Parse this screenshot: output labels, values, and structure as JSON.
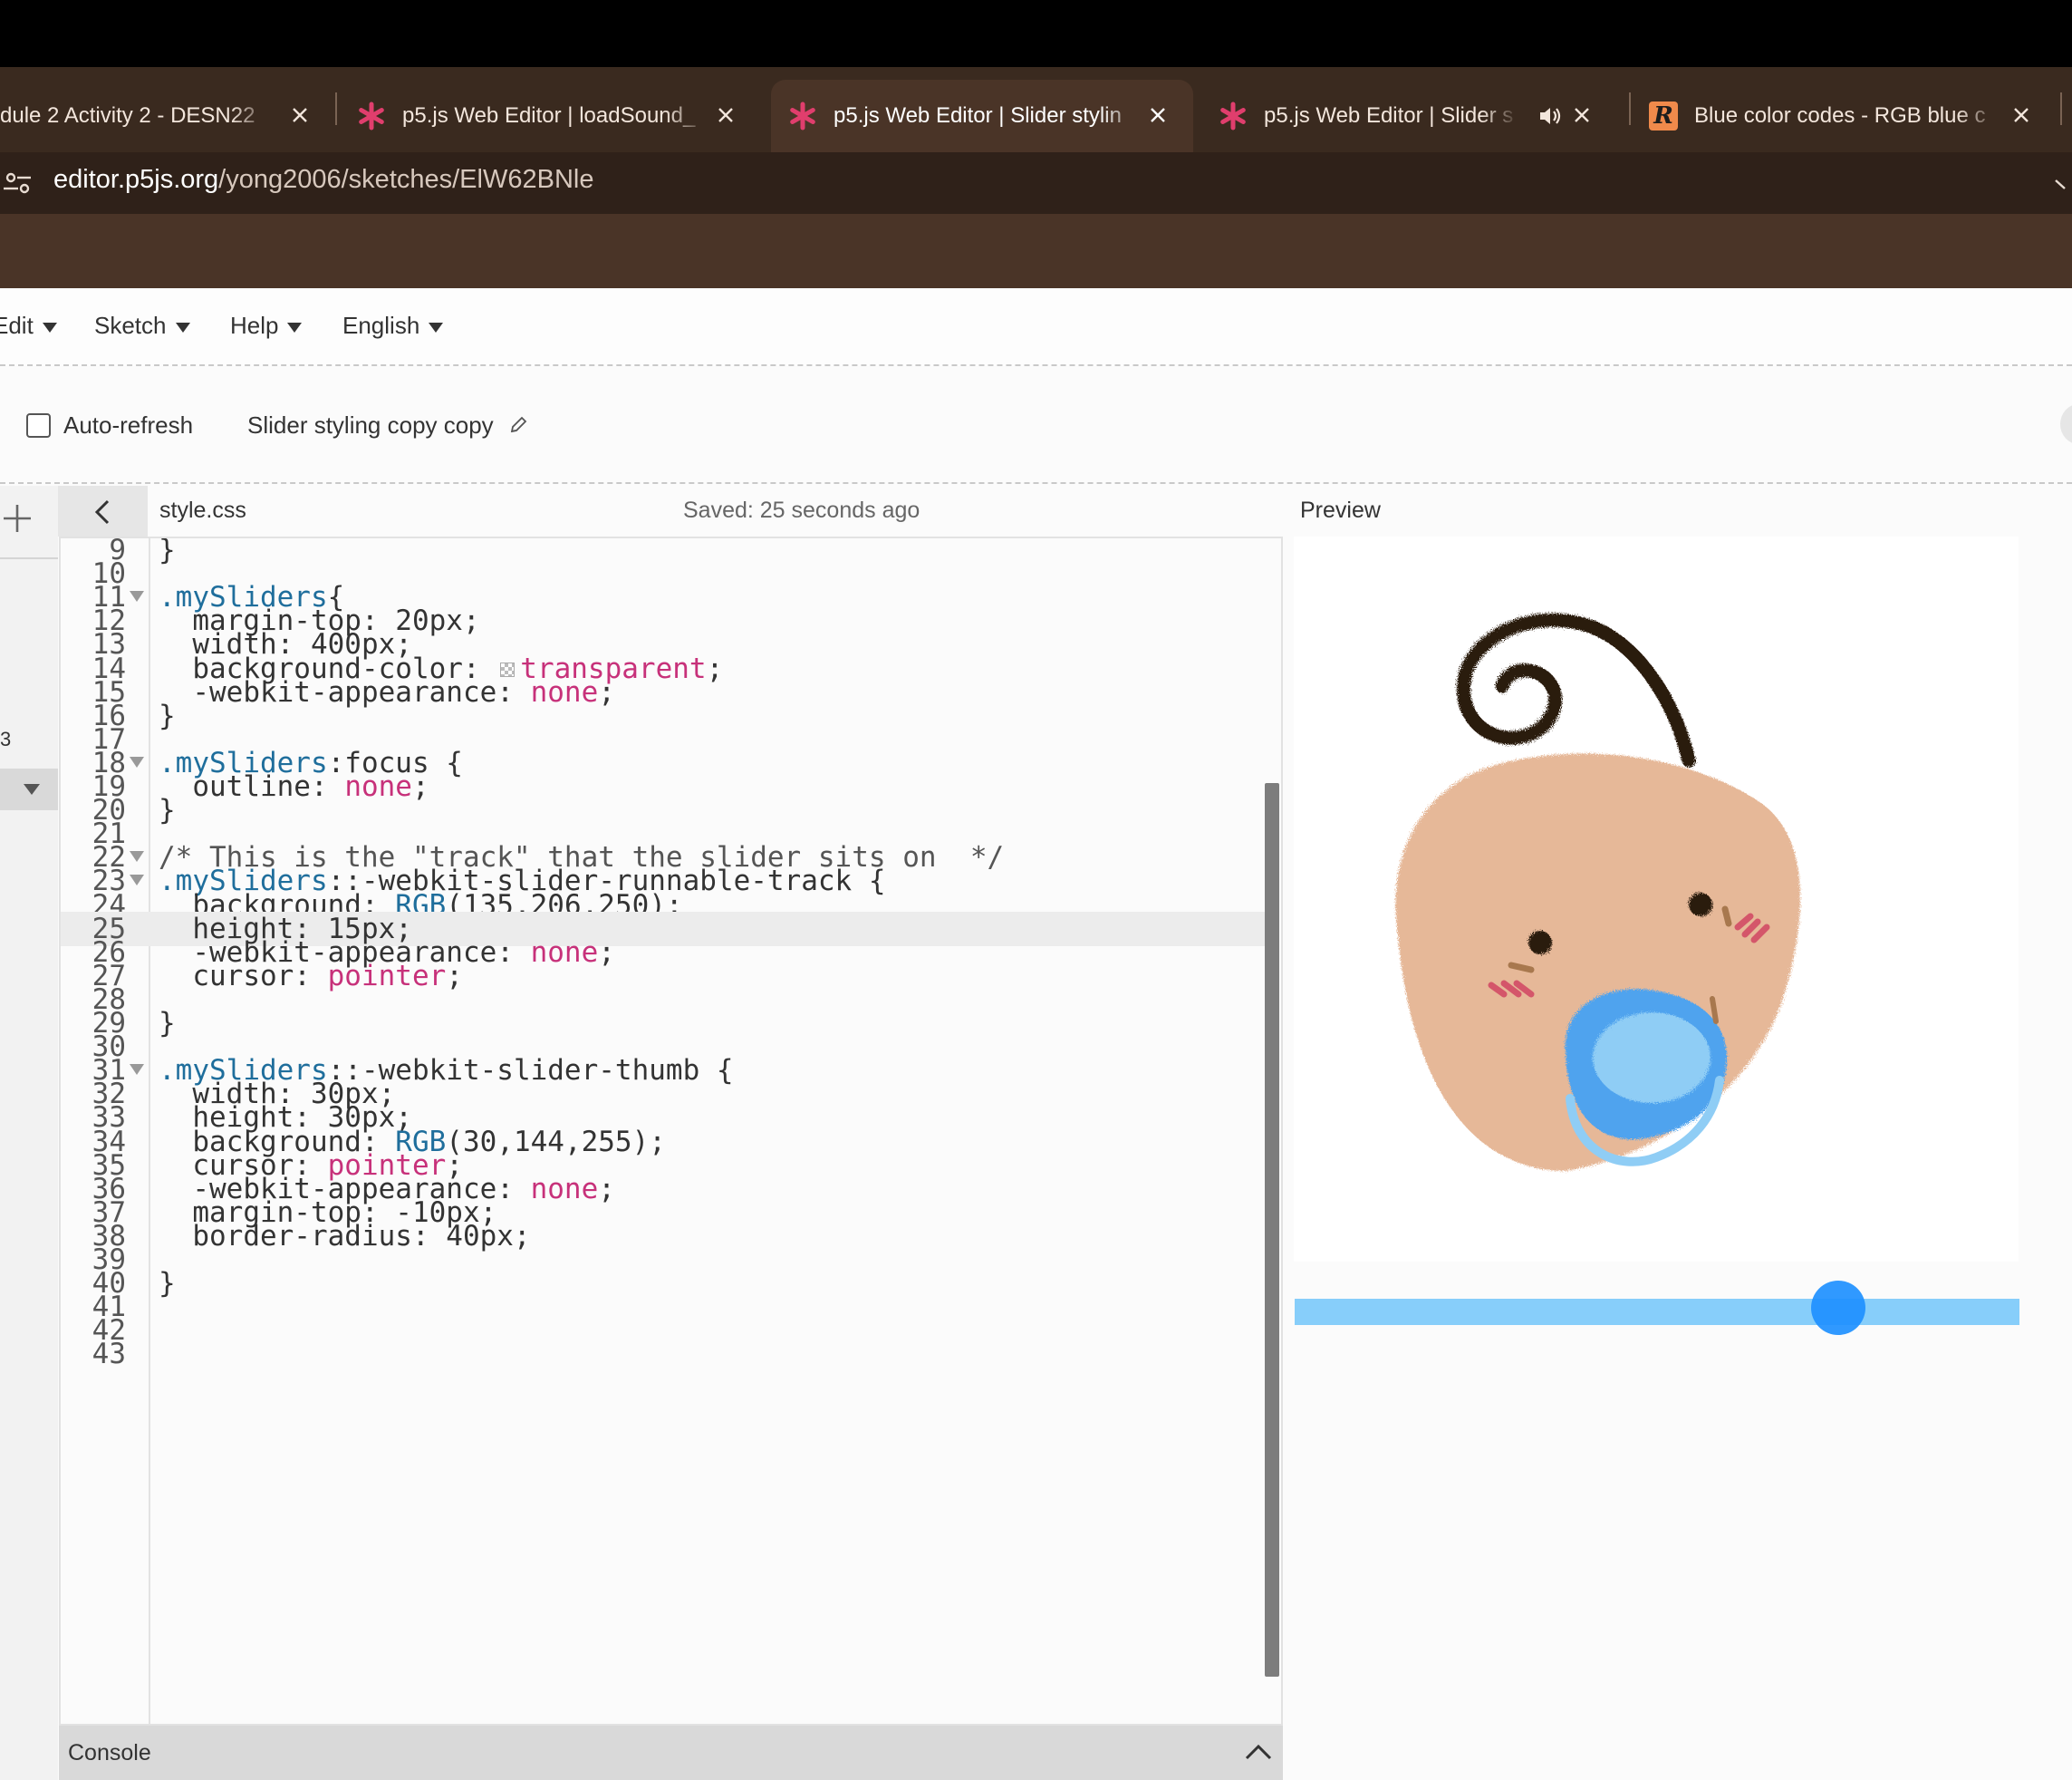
{
  "browser": {
    "tabs": [
      {
        "title": "dule 2 Activity 2 - DESN22",
        "active": false,
        "icon": "doc-icon"
      },
      {
        "title": "p5.js Web Editor | loadSound_",
        "active": false,
        "icon": "p5-asterisk-icon"
      },
      {
        "title": "p5.js Web Editor | Slider stylin",
        "active": true,
        "icon": "p5-asterisk-icon"
      },
      {
        "title": "p5.js Web Editor | Slider s",
        "active": false,
        "icon": "p5-asterisk-icon",
        "audio": true
      },
      {
        "title": "Blue color codes - RGB blue c",
        "active": false,
        "icon": "r-logo-icon",
        "logo_letter": "R"
      }
    ],
    "url": {
      "domain": "editor.p5js.org",
      "path": "/yong2006/sketches/ElW62BNle"
    },
    "accent": "#e03e6d"
  },
  "editor": {
    "menu": [
      {
        "label": "Edit"
      },
      {
        "label": "Sketch"
      },
      {
        "label": "Help"
      },
      {
        "label": "English"
      }
    ],
    "toolbar": {
      "auto_refresh_label": "Auto-refresh",
      "auto_refresh_checked": false,
      "sketch_name": "Slider styling copy copy"
    },
    "sidebar": {
      "partial_number": "3"
    },
    "file": {
      "name": "style.css",
      "saved_status": "Saved: 25 seconds ago"
    },
    "preview_label": "Preview",
    "console_label": "Console",
    "code_lines": [
      {
        "n": "9",
        "fold": false,
        "text": "}"
      },
      {
        "n": "10",
        "fold": false,
        "text": ""
      },
      {
        "n": "11",
        "fold": true,
        "text": ".mySliders{"
      },
      {
        "n": "12",
        "fold": false,
        "text": "  margin-top: 20px;"
      },
      {
        "n": "13",
        "fold": false,
        "text": "  width: 400px;"
      },
      {
        "n": "14",
        "fold": false,
        "text": "  background-color: transparent;"
      },
      {
        "n": "15",
        "fold": false,
        "text": "  -webkit-appearance: none;"
      },
      {
        "n": "16",
        "fold": false,
        "text": "}"
      },
      {
        "n": "17",
        "fold": false,
        "text": ""
      },
      {
        "n": "18",
        "fold": true,
        "text": ".mySliders:focus {"
      },
      {
        "n": "19",
        "fold": false,
        "text": "  outline: none;"
      },
      {
        "n": "20",
        "fold": false,
        "text": "}"
      },
      {
        "n": "21",
        "fold": false,
        "text": ""
      },
      {
        "n": "22",
        "fold": true,
        "text": "/* This is the \"track\" that the slider sits on  */"
      },
      {
        "n": "23",
        "fold": true,
        "text": ".mySliders::-webkit-slider-runnable-track {"
      },
      {
        "n": "24",
        "fold": false,
        "text": "  background: RGB(135,206,250);"
      },
      {
        "n": "25",
        "fold": false,
        "text": "  height: 15px;",
        "highlight": true
      },
      {
        "n": "26",
        "fold": false,
        "text": "  -webkit-appearance: none;"
      },
      {
        "n": "27",
        "fold": false,
        "text": "  cursor: pointer;"
      },
      {
        "n": "28",
        "fold": false,
        "text": ""
      },
      {
        "n": "29",
        "fold": false,
        "text": "}"
      },
      {
        "n": "30",
        "fold": false,
        "text": ""
      },
      {
        "n": "31",
        "fold": true,
        "text": ".mySliders::-webkit-slider-thumb {"
      },
      {
        "n": "32",
        "fold": false,
        "text": "  width: 30px;"
      },
      {
        "n": "33",
        "fold": false,
        "text": "  height: 30px;"
      },
      {
        "n": "34",
        "fold": false,
        "text": "  background: RGB(30,144,255);"
      },
      {
        "n": "35",
        "fold": false,
        "text": "  cursor: pointer;"
      },
      {
        "n": "36",
        "fold": false,
        "text": "  -webkit-appearance: none;"
      },
      {
        "n": "37",
        "fold": false,
        "text": "  margin-top: -10px;"
      },
      {
        "n": "38",
        "fold": false,
        "text": "  border-radius: 40px;"
      },
      {
        "n": "39",
        "fold": false,
        "text": ""
      },
      {
        "n": "40",
        "fold": false,
        "text": "}"
      },
      {
        "n": "41",
        "fold": false,
        "text": ""
      },
      {
        "n": "42",
        "fold": false,
        "text": ""
      },
      {
        "n": "43",
        "fold": false,
        "text": ""
      }
    ],
    "colors": {
      "selector": "#1f6e9c",
      "keyword": "#c7317a",
      "slider_track": "#87cefa",
      "slider_thumb": "#1e90ff",
      "skin": "#e6b898",
      "pacifier": "#4fa3ee"
    },
    "preview_slider": {
      "value_fraction": 0.77
    }
  }
}
